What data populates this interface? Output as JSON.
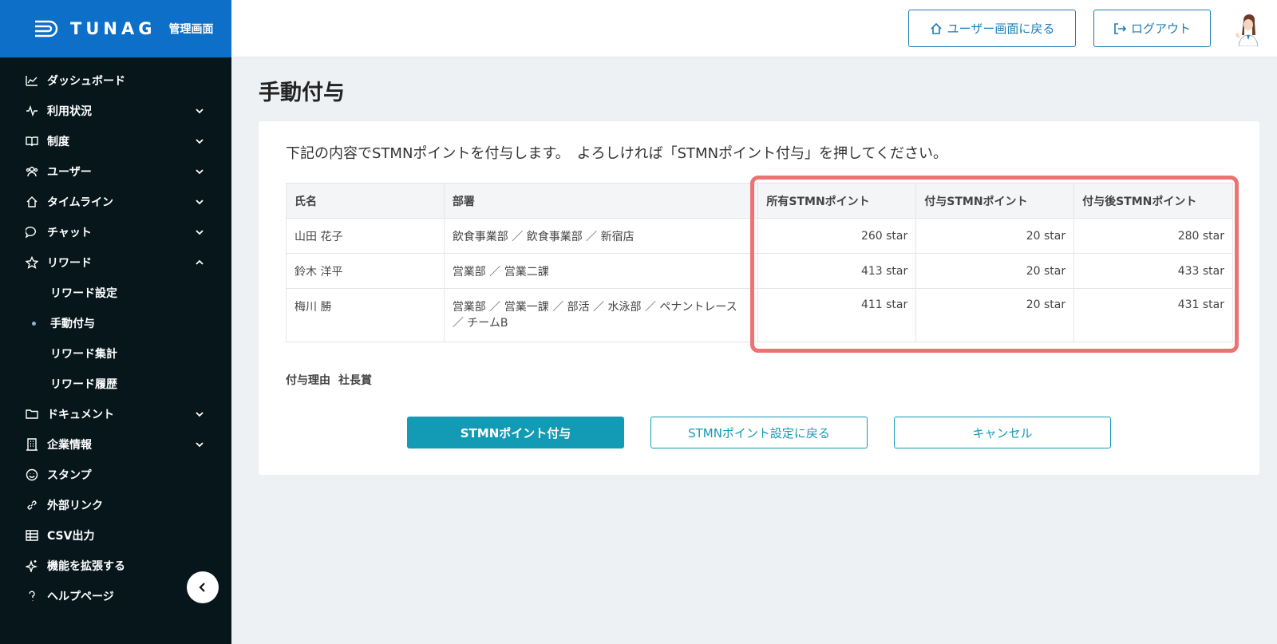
{
  "brand": {
    "name": "TUNAG",
    "sub": "管理画面"
  },
  "nav": {
    "items": [
      {
        "label": "ダッシュボード"
      },
      {
        "label": "利用状況"
      },
      {
        "label": "制度"
      },
      {
        "label": "ユーザー"
      },
      {
        "label": "タイムライン"
      },
      {
        "label": "チャット"
      },
      {
        "label": "リワード"
      },
      {
        "label": "ドキュメント"
      },
      {
        "label": "企業情報"
      },
      {
        "label": "スタンプ"
      },
      {
        "label": "外部リンク"
      },
      {
        "label": "CSV出力"
      },
      {
        "label": "機能を拡張する"
      },
      {
        "label": "ヘルプページ"
      }
    ],
    "reward_sub": [
      {
        "label": "リワード設定"
      },
      {
        "label": "手動付与"
      },
      {
        "label": "リワード集計"
      },
      {
        "label": "リワード履歴"
      }
    ]
  },
  "header": {
    "user_screen": "ユーザー画面に戻る",
    "logout": "ログアウト"
  },
  "page": {
    "title": "手動付与",
    "intro": "下記の内容でSTMNポイントを付与します。　よろしければ「STMNポイント付与」を押してください。"
  },
  "table": {
    "headers": [
      "氏名",
      "部署",
      "所有STMNポイント",
      "付与STMNポイント",
      "付与後STMNポイント"
    ],
    "rows": [
      {
        "name": "山田 花子",
        "dept": "飲食事業部 ／ 飲食事業部 ／ 新宿店",
        "own": "260 star",
        "give": "20 star",
        "after": "280 star"
      },
      {
        "name": "鈴木 洋平",
        "dept": "営業部 ／ 営業二課",
        "own": "413 star",
        "give": "20 star",
        "after": "433 star"
      },
      {
        "name": "梅川 勝",
        "dept": "営業部 ／ 営業一課 ／ 部活 ／ 水泳部 ／ ペナントレース ／ チームB",
        "own": "411 star",
        "give": "20 star",
        "after": "431 star"
      }
    ]
  },
  "reason": {
    "label": "付与理由",
    "value": "社長賞"
  },
  "actions": {
    "grant": "STMNポイント付与",
    "back": "STMNポイント設定に戻る",
    "cancel": "キャンセル"
  },
  "colors": {
    "brand_blue": "#0d6fc7",
    "sidebar": "#06161b",
    "primary": "#139ab5",
    "highlight": "#ed7372"
  }
}
